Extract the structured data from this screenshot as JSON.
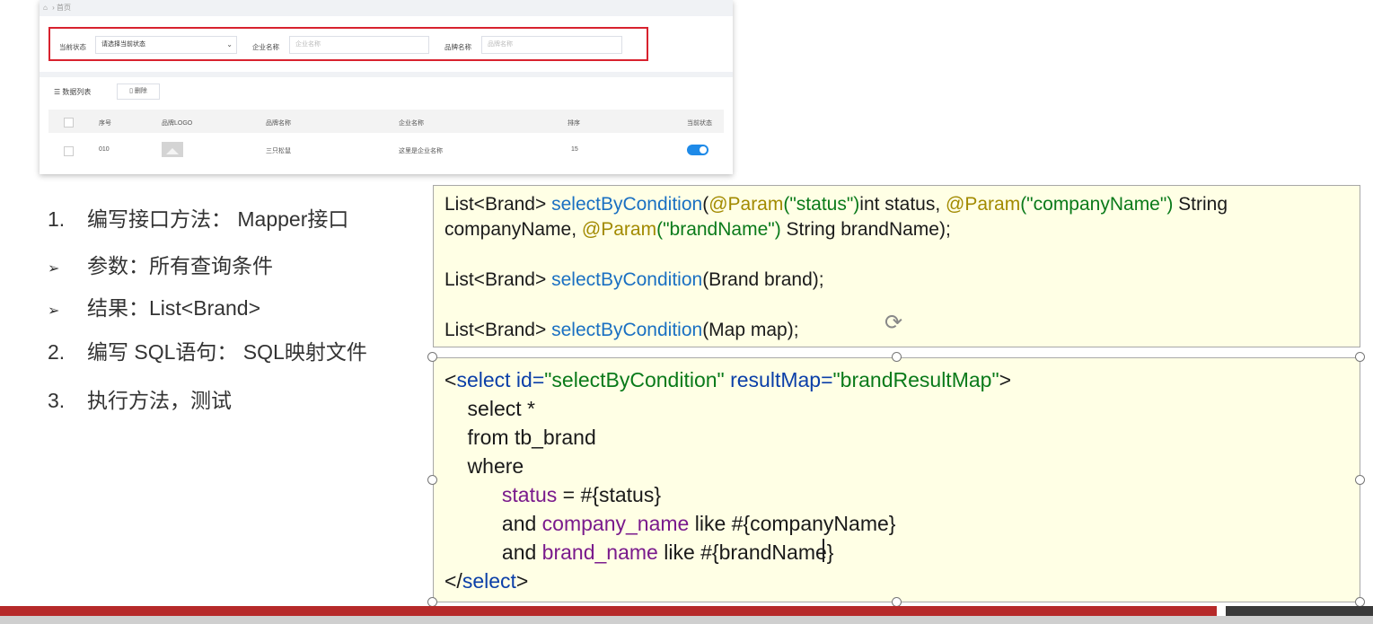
{
  "breadcrumb": {
    "home_icon": "home-icon",
    "label": "首页"
  },
  "filters": {
    "status_label": "当前状态",
    "status_value": "请选择当前状态",
    "company_label": "企业名称",
    "company_placeholder": "企业名称",
    "brand_label": "品牌名称",
    "brand_placeholder": "品牌名称",
    "highlight_color": "#d8222e"
  },
  "table": {
    "title": "数据列表",
    "delete_label": "删除",
    "columns": [
      "序号",
      "品牌LOGO",
      "品牌名称",
      "企业名称",
      "排序",
      "当前状态"
    ],
    "rows": [
      {
        "id": "010",
        "brand_name": "三只松鼠",
        "company_name": "这里是企业名称",
        "order": "15",
        "status_on": true
      }
    ]
  },
  "outline": [
    {
      "marker": "1.",
      "text": "编写接口方法： Mapper接口"
    },
    {
      "marker": "➢",
      "text": "参数：所有查询条件"
    },
    {
      "marker": "➢",
      "text": "结果：List<Brand>"
    },
    {
      "marker": "2.",
      "text": "编写 SQL语句： SQL映射文件"
    },
    {
      "marker": "3.",
      "text": "执行方法，测试"
    }
  ],
  "code_top": {
    "line1_list": "List<Brand> ",
    "method": "selectByCondition",
    "line1_a": "(",
    "anno": "@Param",
    "str_status": "(\"status\")",
    "line1_b": "int status, ",
    "str_company": "(\"companyName\")",
    "line1_c": " String",
    "line2_a": "companyName, ",
    "str_brand": "(\"brandName\")",
    "line2_b": " String brandName);",
    "line3_b": "(Brand brand);",
    "line4_b": "(Map map);"
  },
  "code_bottom": {
    "open_lt": "<",
    "tag": "select",
    "attr_id": " id=",
    "val_id": "\"selectByCondition\"",
    "attr_rm": " resultMap=",
    "val_rm": "\"brandResultMap\"",
    "open_gt": ">",
    "l2": "    select *",
    "l3": "    from tb_brand",
    "l4": "    where",
    "indent": "          ",
    "col_status": "status",
    "l5_rest": " = #{status}",
    "and": "and ",
    "col_company": "company_name",
    "l6_rest": " like #{companyName}",
    "col_brand": "brand_name",
    "l7_rest": " like #{brandName}",
    "close_lt": "</",
    "close_gt": ">"
  },
  "colors": {
    "method": "#1a70c2",
    "annotation": "#a28a00",
    "string": "#0a7a1a",
    "tag": "#0b3fa8",
    "column": "#7a1a8c",
    "code_bg": "#ffffe5",
    "bar_red": "#b62a2a",
    "toggle_on": "#1e8ae8"
  }
}
